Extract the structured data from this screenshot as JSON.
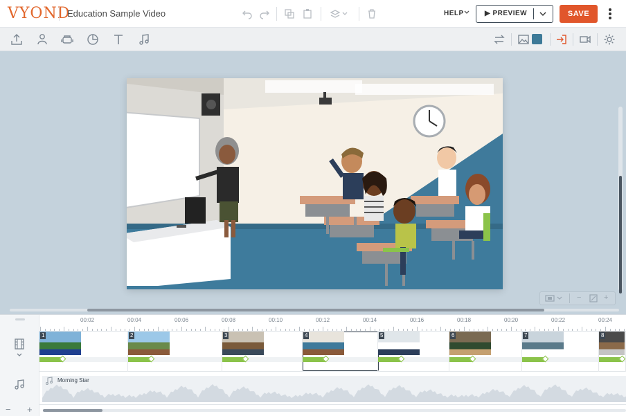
{
  "app": {
    "logo": "VYOND",
    "title": "Education Sample Video"
  },
  "header": {
    "help_label": "HELP",
    "preview_label": "▶ PREVIEW",
    "save_label": "SAVE",
    "accent": "#e1562b"
  },
  "toolbar": {
    "left_tools": [
      "upload-icon",
      "character-icon",
      "prop-icon",
      "chart-icon",
      "text-icon",
      "audio-icon"
    ],
    "right_tools": [
      "swap-icon",
      "image-icon",
      "color-swatch",
      "enter-icon",
      "camera-icon",
      "settings-icon"
    ],
    "swatch_color": "#3d7a98"
  },
  "timeline": {
    "ticks": [
      "00:02",
      "00:04",
      "00:06",
      "00:08",
      "00:10",
      "00:12",
      "00:14",
      "00:16",
      "00:18",
      "00:20",
      "00:22",
      "00:24"
    ],
    "scenes": [
      {
        "num": "1"
      },
      {
        "num": "2"
      },
      {
        "num": "3"
      },
      {
        "num": "4"
      },
      {
        "num": "5"
      },
      {
        "num": "6"
      },
      {
        "num": "7"
      },
      {
        "num": "8"
      }
    ],
    "audio_label": "Morning Star",
    "zoom_minus": "−",
    "zoom_plus": "+"
  }
}
